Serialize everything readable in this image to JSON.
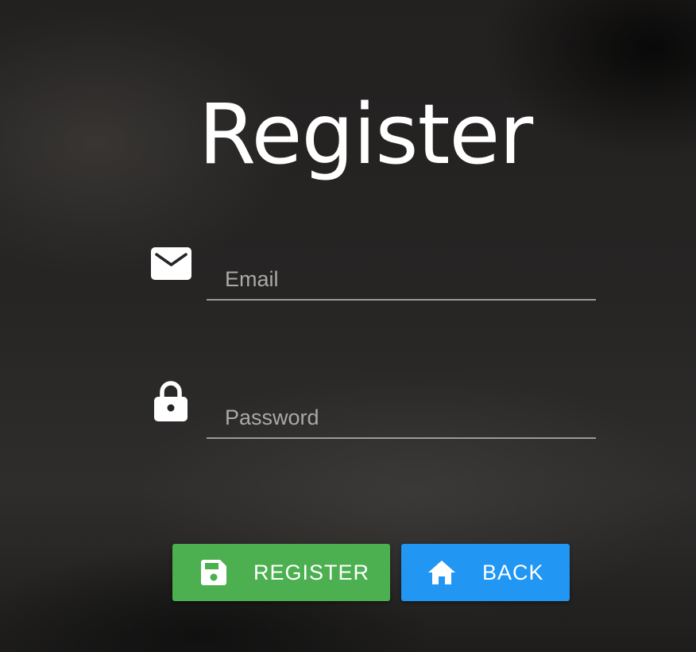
{
  "page": {
    "title": "Register"
  },
  "form": {
    "email": {
      "placeholder": "Email",
      "value": "",
      "icon": "envelope-icon"
    },
    "password": {
      "placeholder": "Password",
      "value": "",
      "icon": "lock-icon"
    }
  },
  "buttons": {
    "register": {
      "label": "REGISTER",
      "icon": "floppy-disk-icon",
      "color": "#4caf50"
    },
    "back": {
      "label": "BACK",
      "icon": "home-icon",
      "color": "#2196f3"
    }
  },
  "colors": {
    "text": "#ffffff",
    "placeholder": "#a9a9a9",
    "underline": "#9a9a9a"
  }
}
